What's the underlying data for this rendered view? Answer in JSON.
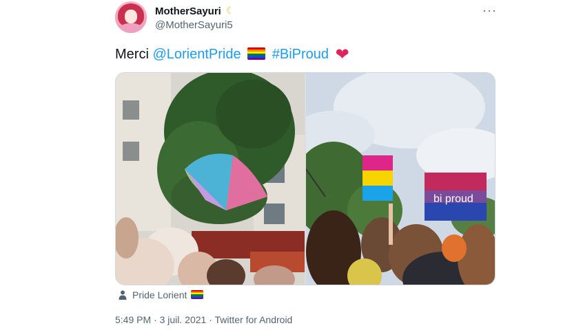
{
  "author": {
    "display_name": "MotherSayuri",
    "badge_icon": "crescent-moon-icon",
    "handle": "@MotherSayuri5"
  },
  "tweet": {
    "text_prefix": "Merci",
    "mention": "@LorientPride",
    "hashtag": "#BiProud",
    "emoji_flag": "rainbow-flag-icon",
    "emoji_heart": "red-heart-icon"
  },
  "media": {
    "photos": [
      "pride-crowd-rainbow-umbrella-photo",
      "bi-pan-signs-crowd-photo"
    ]
  },
  "location": {
    "icon": "person-icon",
    "name": "Pride Lorient",
    "emoji_flag": "rainbow-flag-icon"
  },
  "meta": {
    "time": "5:49 PM",
    "separator": "·",
    "date": "3 juil. 2021",
    "source": "Twitter for Android"
  },
  "colors": {
    "link": "#1d9bf0",
    "secondary_text": "#536471",
    "heart": "#e0245e",
    "rainbow": [
      "#e40303",
      "#ff8c00",
      "#ffed00",
      "#008026",
      "#004dff",
      "#750787"
    ]
  }
}
